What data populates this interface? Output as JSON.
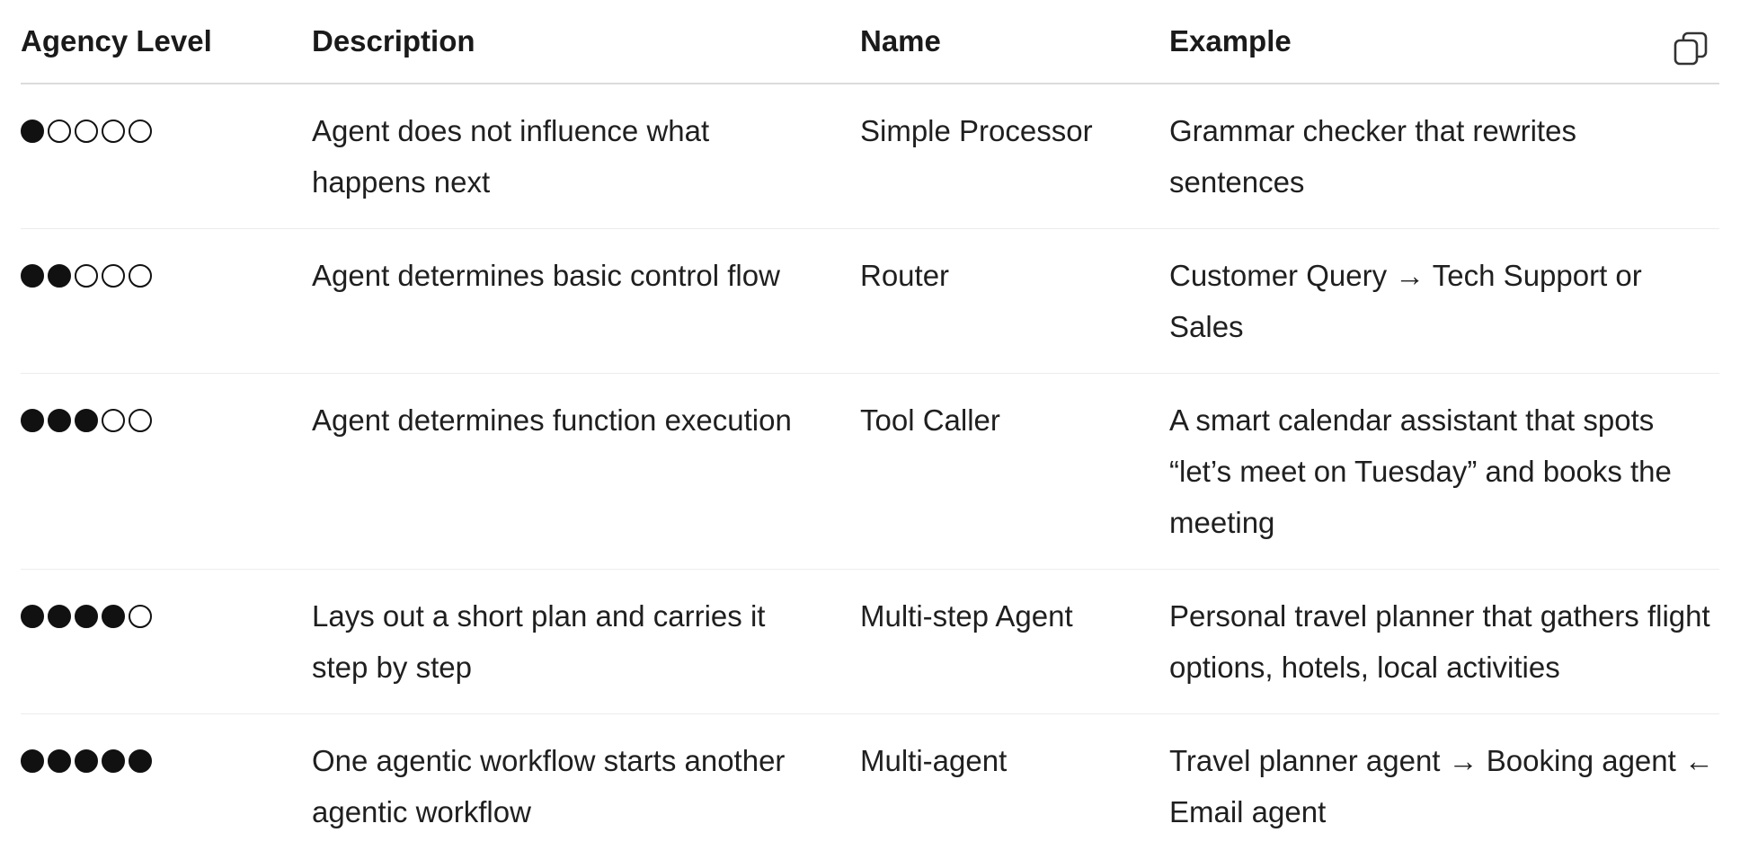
{
  "table": {
    "headers": [
      "Agency Level",
      "Description",
      "Name",
      "Example"
    ],
    "copy_icon": "copy-icon",
    "rows": [
      {
        "level": 1,
        "description": "Agent does not influence what happens next",
        "name": "Simple Processor",
        "example": "Grammar checker that rewrites sentences"
      },
      {
        "level": 2,
        "description": "Agent determines basic control flow",
        "name": "Router",
        "example": "Customer Query → Tech Support or Sales"
      },
      {
        "level": 3,
        "description": "Agent determines function execution",
        "name": "Tool Caller",
        "example": "A smart calendar assistant that spots “let’s meet on Tuesday” and books the meeting"
      },
      {
        "level": 4,
        "description": "Lays out a short plan and carries it step by step",
        "name": "Multi-step Agent",
        "example": "Personal travel planner that gathers flight options, hotels, local activities"
      },
      {
        "level": 5,
        "description": "One agentic workflow starts another agentic workflow",
        "name": "Multi-agent",
        "example": "Travel planner agent → Booking agent ← Email agent"
      }
    ],
    "max_level": 5
  }
}
